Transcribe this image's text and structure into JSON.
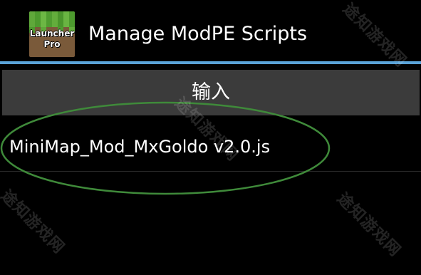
{
  "action_bar": {
    "icon": {
      "name": "launcher-pro-icon",
      "line1": "Launcher",
      "line2": "Pro"
    },
    "title": "Manage ModPE Scripts"
  },
  "import_button": {
    "label": "输入"
  },
  "scripts": [
    {
      "name": "MiniMap_Mod_MxGoldo v2.0.js"
    }
  ],
  "watermark": {
    "text": "途知游戏网"
  },
  "colors": {
    "background": "#000000",
    "accent_divider": "#5aa3d8",
    "button_background": "#3b3b3b",
    "highlight_ellipse": "#3f8a3a",
    "text": "#ffffff"
  }
}
